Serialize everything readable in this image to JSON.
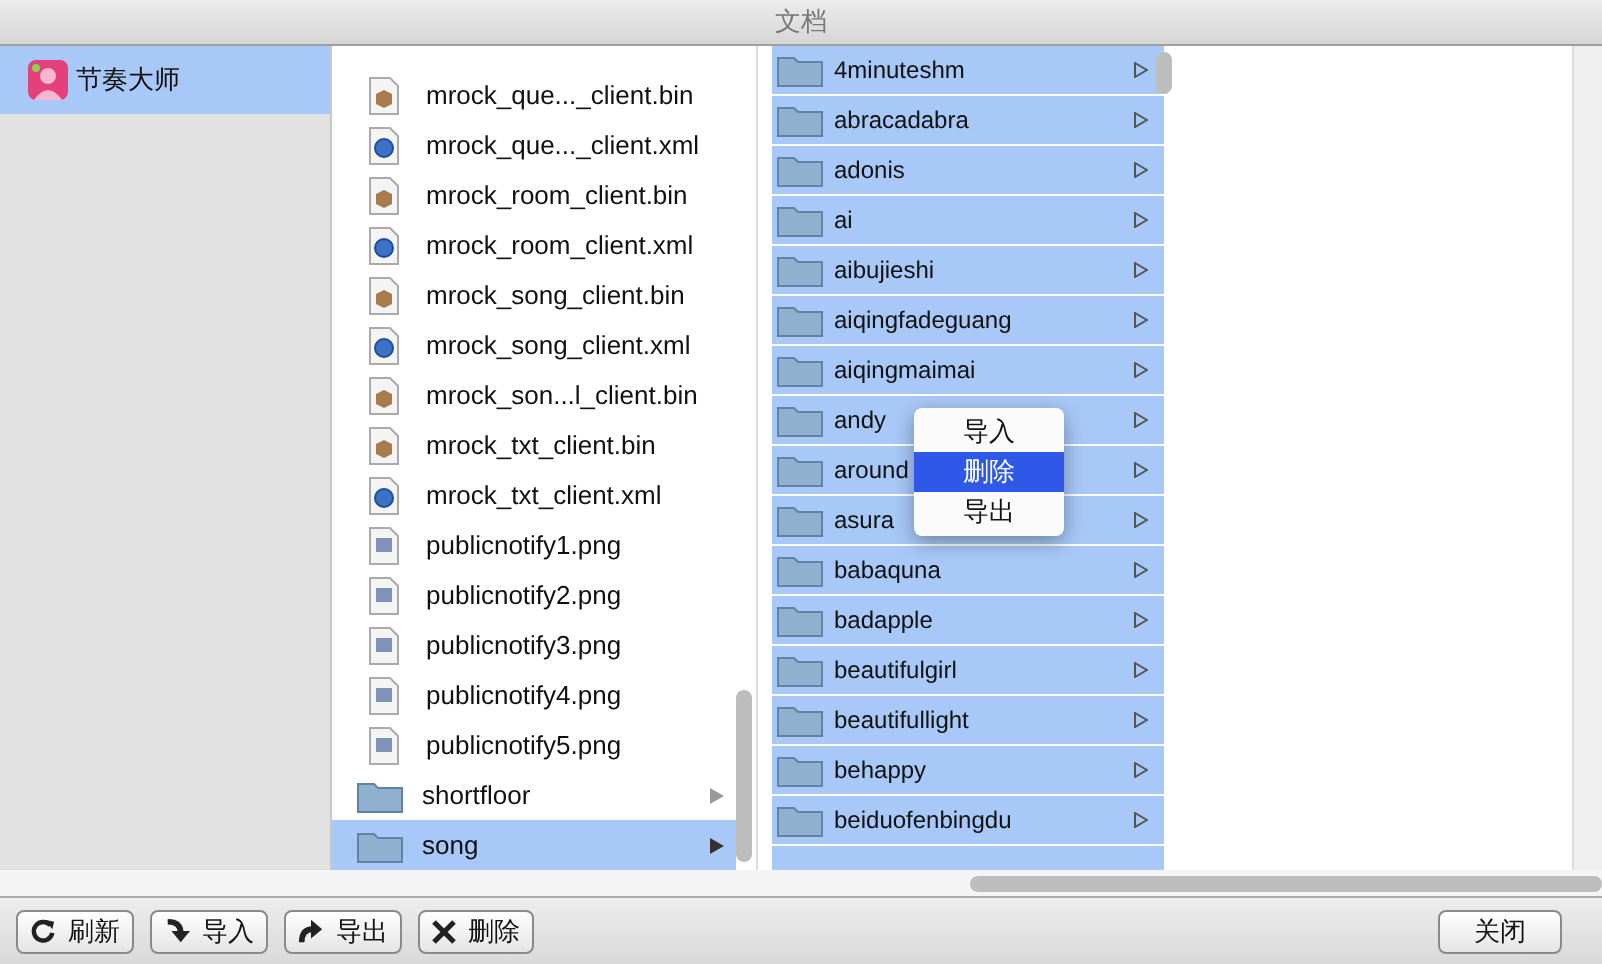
{
  "window": {
    "title": "文档"
  },
  "sidebar": {
    "items": [
      {
        "label": "节奏大师",
        "selected": true
      }
    ]
  },
  "file_column": {
    "items": [
      {
        "name": "mrock_que..._client.bin",
        "kind": "bin",
        "selected": false
      },
      {
        "name": "mrock_que..._client.xml",
        "kind": "xml",
        "selected": false
      },
      {
        "name": "mrock_room_client.bin",
        "kind": "bin",
        "selected": false
      },
      {
        "name": "mrock_room_client.xml",
        "kind": "xml",
        "selected": false
      },
      {
        "name": "mrock_song_client.bin",
        "kind": "bin",
        "selected": false
      },
      {
        "name": "mrock_song_client.xml",
        "kind": "xml",
        "selected": false
      },
      {
        "name": "mrock_son...l_client.bin",
        "kind": "bin",
        "selected": false
      },
      {
        "name": "mrock_txt_client.bin",
        "kind": "bin",
        "selected": false
      },
      {
        "name": "mrock_txt_client.xml",
        "kind": "xml",
        "selected": false
      },
      {
        "name": "publicnotify1.png",
        "kind": "png",
        "selected": false
      },
      {
        "name": "publicnotify2.png",
        "kind": "png",
        "selected": false
      },
      {
        "name": "publicnotify3.png",
        "kind": "png",
        "selected": false
      },
      {
        "name": "publicnotify4.png",
        "kind": "png",
        "selected": false
      },
      {
        "name": "publicnotify5.png",
        "kind": "png",
        "selected": false
      },
      {
        "name": "shortfloor",
        "kind": "folder",
        "selected": false
      },
      {
        "name": "song",
        "kind": "folder",
        "selected": true
      }
    ]
  },
  "song_column": {
    "items": [
      {
        "name": "4minuteshm",
        "selected": true
      },
      {
        "name": "abracadabra",
        "selected": true
      },
      {
        "name": "adonis",
        "selected": true
      },
      {
        "name": "ai",
        "selected": true
      },
      {
        "name": "aibujieshi",
        "selected": true
      },
      {
        "name": "aiqingfadeguang",
        "selected": true
      },
      {
        "name": "aiqingmaimai",
        "selected": true
      },
      {
        "name": "andy",
        "selected": true
      },
      {
        "name": "around",
        "selected": true
      },
      {
        "name": "asura",
        "selected": true
      },
      {
        "name": "babaquna",
        "selected": true
      },
      {
        "name": "badapple",
        "selected": true
      },
      {
        "name": "beautifulgirl",
        "selected": true
      },
      {
        "name": "beautifullight",
        "selected": true
      },
      {
        "name": "behappy",
        "selected": true
      },
      {
        "name": "beiduofenbingdu",
        "selected": true
      }
    ]
  },
  "context_menu": {
    "items": [
      {
        "label": "导入",
        "selected": false
      },
      {
        "label": "删除",
        "selected": true
      },
      {
        "label": "导出",
        "selected": false
      }
    ]
  },
  "toolbar": {
    "buttons": [
      {
        "label": "刷新",
        "kind": "refresh"
      },
      {
        "label": "导入",
        "kind": "import"
      },
      {
        "label": "导出",
        "kind": "export"
      },
      {
        "label": "删除",
        "kind": "delete"
      }
    ],
    "close": "关闭"
  }
}
